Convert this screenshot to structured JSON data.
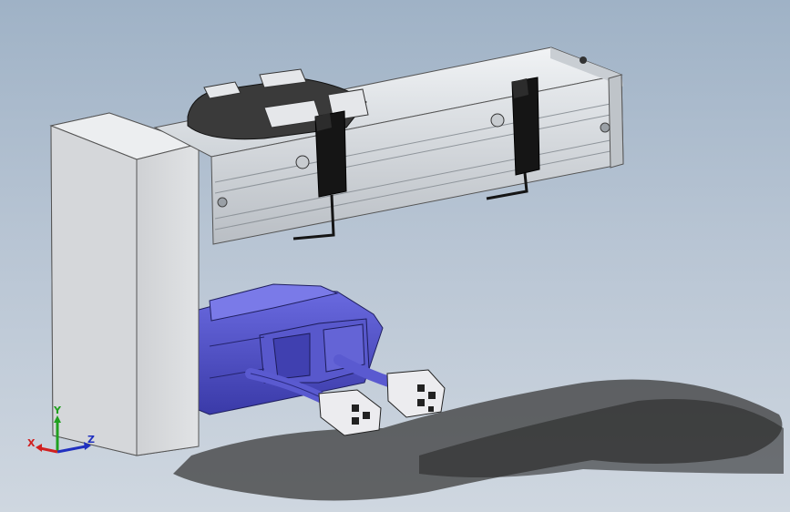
{
  "viewport": {
    "background_top": "#9fb2c6",
    "background_bottom": "#cfd7e0"
  },
  "model": {
    "rail_color": "#d9dde2",
    "column_color": "#d2d4d7",
    "motor_color": "#4e4ec8",
    "sensor_color": "#141414",
    "carriage_color": "#2b2b2b"
  },
  "triad": {
    "x_label": "X",
    "y_label": "Y",
    "z_label": "Z",
    "x_color": "#d12020",
    "y_color": "#20a020",
    "z_color": "#2030c0",
    "icon": "coordinate-triad-icon"
  }
}
